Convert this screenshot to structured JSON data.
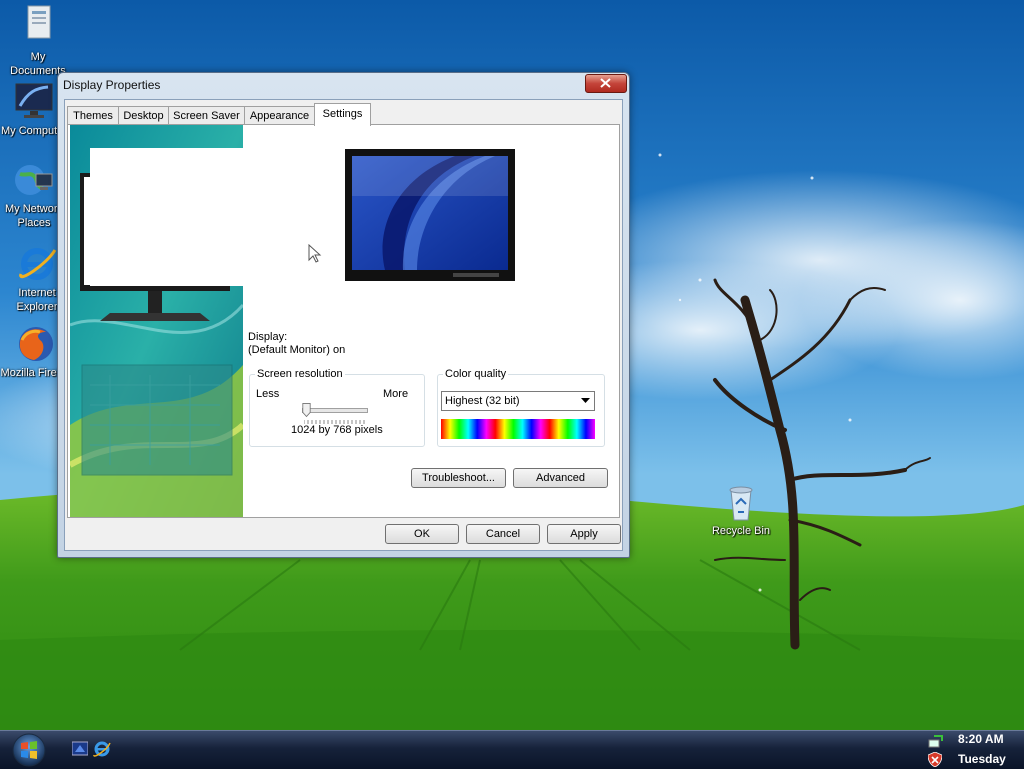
{
  "desktop": {
    "icons": [
      {
        "label": "My\nDocuments",
        "icon": "folder-icon"
      },
      {
        "label": "My Computer",
        "icon": "computer-icon"
      },
      {
        "label": "My Network\nPlaces",
        "icon": "network-icon"
      },
      {
        "label": "Internet\nExplorer",
        "icon": "ie-icon"
      },
      {
        "label": "Mozilla Firefox",
        "icon": "firefox-icon"
      },
      {
        "label": "Recycle Bin",
        "icon": "recycle-bin-icon"
      }
    ]
  },
  "window": {
    "title": "Display Properties",
    "tabs": [
      "Themes",
      "Desktop",
      "Screen Saver",
      "Appearance",
      "Settings"
    ],
    "active_tab": "Settings",
    "display_label": "Display:",
    "display_value": "(Default Monitor) on",
    "resolution": {
      "legend": "Screen resolution",
      "less": "Less",
      "more": "More",
      "value_text": "1024 by 768 pixels",
      "slider_fraction": 0
    },
    "color_quality": {
      "legend": "Color quality",
      "selected": "Highest (32 bit)"
    },
    "buttons": {
      "troubleshoot": "Troubleshoot...",
      "advanced": "Advanced",
      "ok": "OK",
      "cancel": "Cancel",
      "apply": "Apply"
    }
  },
  "taskbar": {
    "time": "8:20 AM",
    "day": "Tuesday"
  },
  "colors": {
    "sky": "#2f86cf",
    "grass": "#3c9a1c",
    "window_frame": "#c8d6e6",
    "taskbar": "#16223a"
  }
}
